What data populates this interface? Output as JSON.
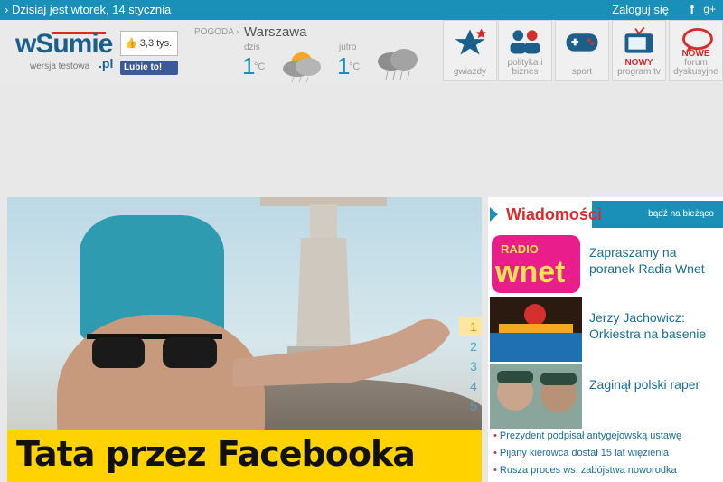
{
  "topbar": {
    "date_text": "› Dzisiaj jest wtorek, 14 stycznia",
    "login": "Zaloguj się",
    "facebook_icon": "f",
    "gplus_icon": "g+"
  },
  "logo": {
    "main": "wSumie",
    "pl": ".pl",
    "sub": "wersja testowa"
  },
  "facebook": {
    "count": "3,3 tys.",
    "like_button": "Lubię to!"
  },
  "weather": {
    "label": "POGODA ›",
    "city": "Warszawa",
    "today_label": "dziś",
    "tomorrow_label": "jutro",
    "today_temp": "1",
    "tomorrow_temp": "1",
    "unit": "°C"
  },
  "nav": [
    {
      "label": "gwiazdy",
      "icon": "star-icon"
    },
    {
      "label": "polityka i biznes",
      "icon": "people-icon"
    },
    {
      "label": "sport",
      "icon": "gamepad-icon"
    },
    {
      "label_new": "NOWY",
      "label": "program tv",
      "icon": "tv-icon"
    },
    {
      "label_new": "NOWE",
      "label": "forum dyskusyjne",
      "icon": "chat-icon"
    }
  ],
  "hero": {
    "caption": "Tata przez Facebooka",
    "pager": [
      "1",
      "2",
      "3",
      "4",
      "5"
    ],
    "active_page": "1"
  },
  "sidebar": {
    "title": "Wiadomości",
    "more": "bądź na bieżąco",
    "items": [
      {
        "text": "Zapraszamy na poranek Radia Wnet",
        "thumb_text_1": "RADIO",
        "thumb_text_2": "wnet"
      },
      {
        "text": "Jerzy Jachowicz: Orkiestra na basenie"
      },
      {
        "text": "Zaginął polski raper"
      }
    ],
    "links": [
      "Prezydent podpisał antygejowską ustawę",
      "Pijany kierowca dostał 15 lat więzienia",
      "Rusza proces ws. zabójstwa noworodka"
    ]
  },
  "colors": {
    "accent": "#1a8fb8",
    "red": "#d32f2f",
    "yellow": "#ffd200"
  }
}
